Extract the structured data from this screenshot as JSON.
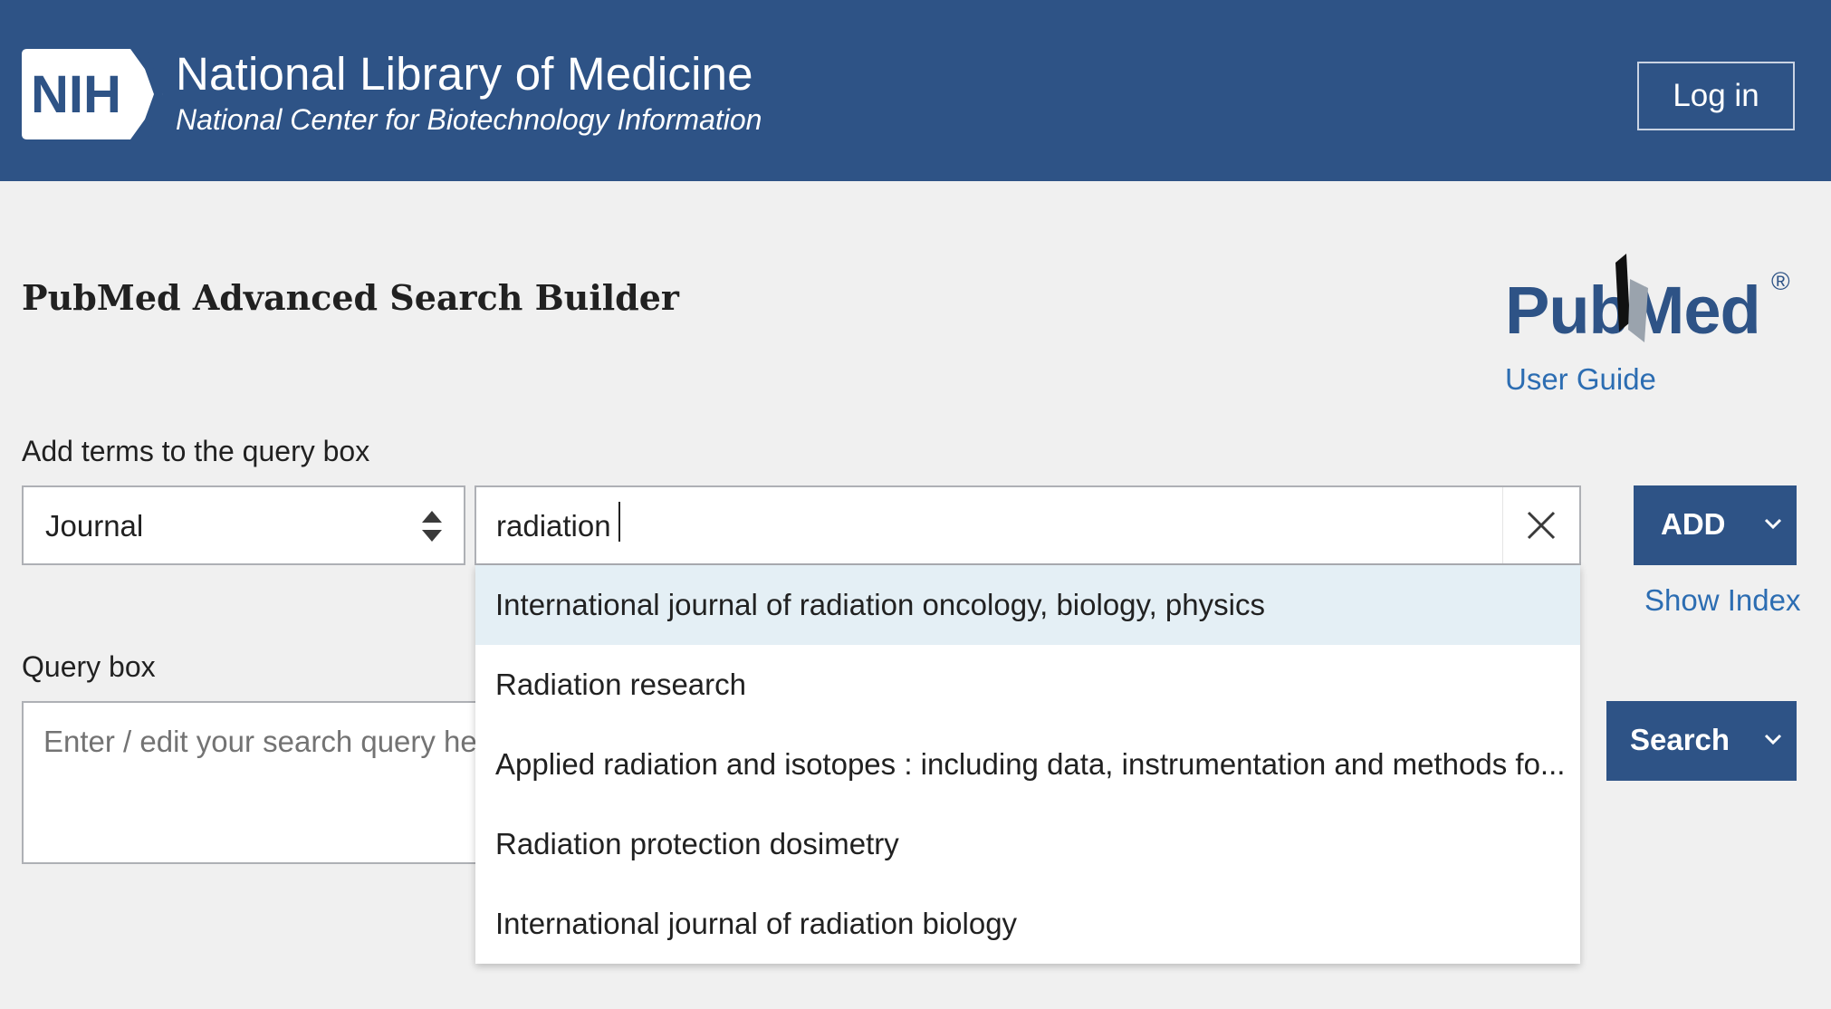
{
  "header": {
    "logo_text": "NIH",
    "title": "National Library of Medicine",
    "subtitle": "National Center for Biotechnology Information",
    "login_label": "Log in",
    "background": "#2e5386"
  },
  "page": {
    "heading": "PubMed Advanced Search Builder",
    "brand_logo_text": "PubMed",
    "user_guide_label": "User Guide"
  },
  "builder": {
    "add_terms_label": "Add terms to the query box",
    "field_select_value": "Journal",
    "term_input_value": "radiation",
    "add_button_label": "ADD",
    "show_index_label": "Show Index",
    "suggestions": [
      "International journal of radiation oncology, biology, physics",
      "Radiation research",
      "Applied radiation and isotopes : including data, instrumentation and methods fo...",
      "Radiation protection dosimetry",
      "International journal of radiation biology"
    ],
    "active_suggestion_index": 0
  },
  "query": {
    "label": "Query box",
    "placeholder": "Enter / edit your search query here",
    "search_button_label": "Search"
  },
  "icons": {
    "field_select": "sort-arrows-icon",
    "clear": "close-icon",
    "add_menu": "chevron-down-icon",
    "search_menu": "chevron-down-icon"
  },
  "colors": {
    "brand_blue": "#2e5386",
    "link_blue": "#2c6db2",
    "active_suggestion": "#e4eff5",
    "page_background": "#f0f0f0"
  }
}
